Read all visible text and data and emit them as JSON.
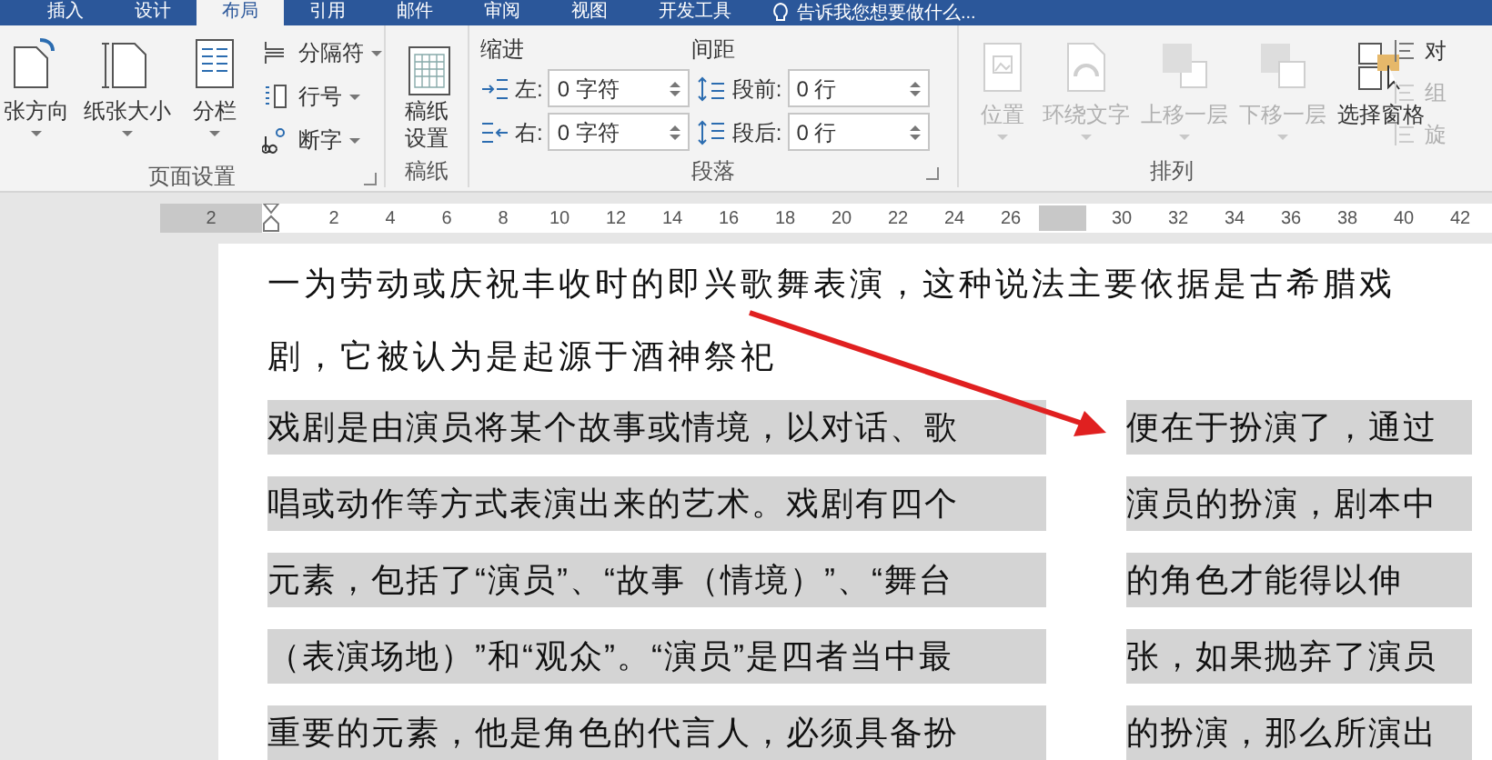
{
  "tabs": [
    {
      "label": "插入",
      "selected": false
    },
    {
      "label": "设计",
      "selected": false
    },
    {
      "label": "布局",
      "selected": true
    },
    {
      "label": "引用",
      "selected": false
    },
    {
      "label": "邮件",
      "selected": false
    },
    {
      "label": "审阅",
      "selected": false
    },
    {
      "label": "视图",
      "selected": false
    },
    {
      "label": "开发工具",
      "selected": false
    }
  ],
  "tell_me": "告诉我您想要做什么...",
  "groups": [
    {
      "kind": "page_setup",
      "label": "页面设置",
      "large": [
        {
          "label": "张方向"
        },
        {
          "label": "纸张大小"
        },
        {
          "label": "分栏"
        }
      ],
      "small": [
        {
          "label": "分隔符"
        },
        {
          "label": "行号"
        },
        {
          "label": "断字"
        }
      ]
    },
    {
      "kind": "manuscript",
      "label": "稿纸",
      "button": "稿纸设置"
    },
    {
      "kind": "paragraph",
      "label": "段落",
      "indent_title": "缩进",
      "spacing_title": "间距",
      "fields": [
        {
          "label": "左:",
          "value": "0 字符"
        },
        {
          "label": "右:",
          "value": "0 字符"
        },
        {
          "label": "段前:",
          "value": "0 行"
        },
        {
          "label": "段后:",
          "value": "0 行"
        }
      ]
    },
    {
      "kind": "arrange",
      "label": "排列",
      "large": [
        {
          "label": "位置",
          "disabled": true
        },
        {
          "label": "环绕文字",
          "disabled": true
        },
        {
          "label": "上移一层",
          "disabled": true
        },
        {
          "label": "下移一层",
          "disabled": true
        },
        {
          "label": "选择窗格",
          "disabled": false
        }
      ],
      "small": [
        {
          "label": "对",
          "disabled": false
        },
        {
          "label": "组",
          "disabled": true
        },
        {
          "label": "旋",
          "disabled": true
        }
      ]
    }
  ],
  "ruler": {
    "left_labels": [
      "2"
    ],
    "labels": [
      "2",
      "4",
      "6",
      "8",
      "10",
      "12",
      "14",
      "16",
      "18",
      "20",
      "22",
      "24",
      "26",
      "30",
      "32",
      "34",
      "36",
      "38",
      "40",
      "42"
    ]
  },
  "document": {
    "lines": [
      "一为劳动或庆祝丰收时的即兴歌舞表演，这种说法主要依据是古希腊戏",
      "剧，它被认为是起源于酒神祭祀"
    ],
    "left_column": [
      "戏剧是由演员将某个故事或情境，以对话、歌",
      "唱或动作等方式表演出来的艺术。戏剧有四个",
      "元素，包括了“演员”、“故事（情境）”、“舞台",
      "（表演场地）”和“观众”。“演员”是四者当中最",
      "重要的元素，他是角色的代言人，必须具备扮"
    ],
    "right_column": [
      "便在于扮演了，通过",
      "演员的扮演，剧本中",
      "的角色才能得以伸",
      "张，如果抛弃了演员",
      "的扮演，那么所演出"
    ]
  }
}
